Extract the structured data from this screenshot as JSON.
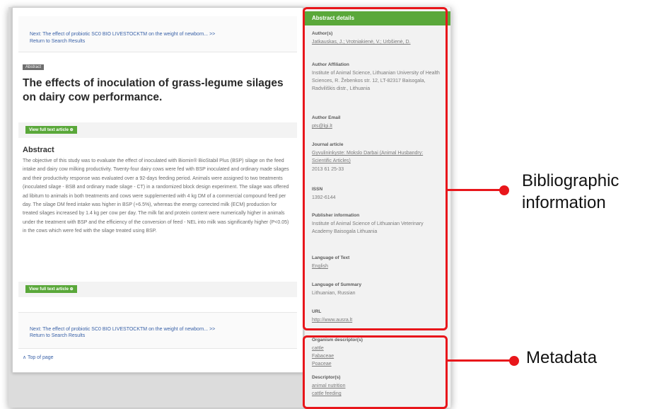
{
  "article": {
    "next_link_top": "Next: The effect of probiotic SC0 BIO LIVESTOCKTM on the weight of newborn... >>",
    "return_link_top": "Return to Search Results",
    "badge": "Abstract",
    "title": "The effects of inoculation of grass-legume silages on dairy cow performance.",
    "view_full_text": "View full text article ⊕",
    "abstract_heading": "Abstract",
    "abstract_text": "The objective of this study was to evaluate the effect of inoculated with Biomin® BioStabil Plus (BSP) silage on the feed intake and dairy cow milking productivity. Twenty-four dairy cows were fed with BSP inoculated and ordinary made silages and their productivity response was evaluated over a 92-days feeding period. Animals were assigned to two treatments (inoculated silage - BSB and ordinary made silage - CT) in a randomized block design experiment. The silage was offered ad libitum to animals in both treatments and cows were supplemented with 4 kg DM of a commercial compound feed per day. The silage DM feed intake was higher in BSP (+6.5%), whereas the energy corrected milk (ECM) production for treated silages increased by 1.4 kg per cow per day. The milk fat and protein content were numerically higher in animals under the treatment with BSP and the efficiency of the conversion of feed - NEL into milk was significantly higher (P<0.05) in the cows which were fed with the silage treated using BSP.",
    "view_full_text_2": "View full text article ⊕",
    "next_link_bottom": "Next: The effect of probiotic SC0 BIO LIVESTOCKTM on the weight of newborn... >>",
    "return_link_bottom": "Return to Search Results",
    "top_of_page": "∧ Top of page"
  },
  "sidebar": {
    "header": "Abstract details",
    "authors_label": "Author(s)",
    "authors_value": "Jatkauskas, J.; Vrotniakienė, V.; Urbšienė, D.",
    "affiliation_label": "Author Affiliation",
    "affiliation_value": "Institute of Animal Science, Lithuanian University of Health Sciences, R. Žebenkos str. 12, LT-82317 Baisogala, Radviliškis distr., Lithuania",
    "email_label": "Author Email",
    "email_value": "pts@lgi.lt",
    "journal_label": "Journal article",
    "journal_value": "Gyvulininkyste: Mokslo Darbai (Animal Husbandry: Scientific Articles)",
    "journal_issue": "2013  61 25-33",
    "issn_label": "ISSN",
    "issn_value": "1392-6144",
    "publisher_label": "Publisher information",
    "publisher_value": "Institute of Animal Science of Lithuanian Veterinary Academy Baisogala Lithuania",
    "lang_text_label": "Language of Text",
    "lang_text_value": "English",
    "lang_summary_label": "Language of Summary",
    "lang_summary_value": "Lithuanian, Russian",
    "url_label": "URL",
    "url_value": "http://www.ausra.lt",
    "organism_label": "Organism descriptor(s)",
    "organism_1": "cattle",
    "organism_2": "Fabaceae",
    "organism_3": "Poaceae",
    "descriptors_label": "Descriptor(s)",
    "descriptor_1": "animal nutrition",
    "descriptor_2": "cattle feeding"
  },
  "callouts": {
    "bibliographic": "Bibliographic information",
    "bib_line1": "Bibliographic",
    "bib_line2": "information",
    "metadata": "Metadata"
  },
  "colors": {
    "accent_green": "#5aa83a",
    "highlight_red": "#e8161b",
    "link_blue": "#3a62a8"
  }
}
